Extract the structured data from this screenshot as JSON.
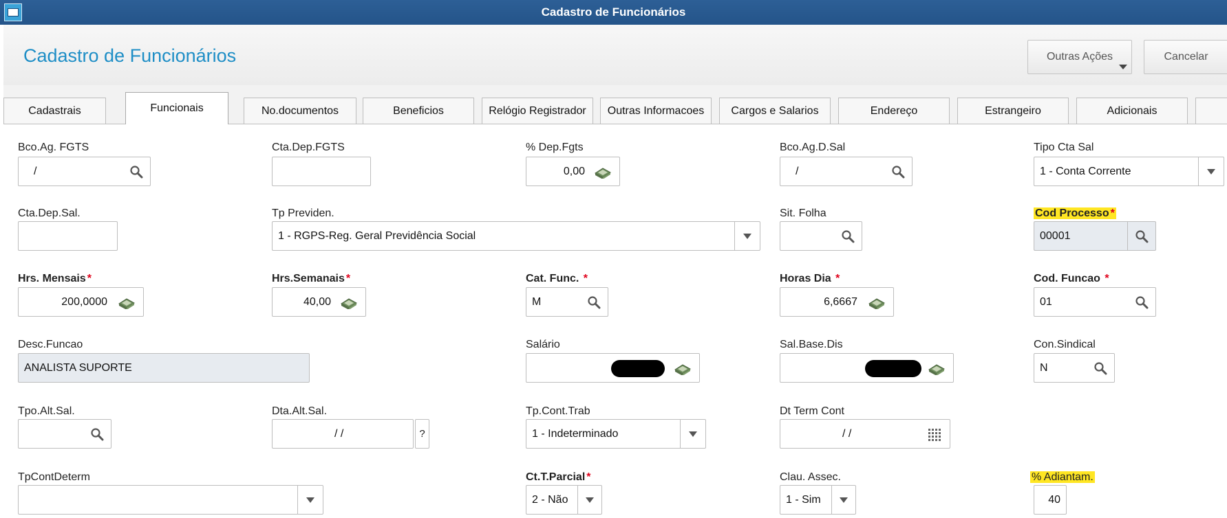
{
  "window": {
    "title": "Cadastro de Funcionários"
  },
  "header": {
    "title": "Cadastro de Funcionários",
    "other_actions": "Outras Ações",
    "cancel": "Cancelar"
  },
  "tabs": [
    {
      "label": "Cadastrais"
    },
    {
      "label": "Funcionais"
    },
    {
      "label": "No.documentos"
    },
    {
      "label": "Beneficios"
    },
    {
      "label": "Relógio Registrador"
    },
    {
      "label": "Outras Informacoes"
    },
    {
      "label": "Cargos e Salarios"
    },
    {
      "label": "Endereço"
    },
    {
      "label": "Estrangeiro"
    },
    {
      "label": "Adicionais"
    }
  ],
  "active_tab": "Funcionais",
  "fields": {
    "bco_ag_fgts": {
      "label": "Bco.Ag. FGTS",
      "value": "/"
    },
    "cta_dep_fgts": {
      "label": "Cta.Dep.FGTS",
      "value": ""
    },
    "pct_dep_fgts": {
      "label": "% Dep.Fgts",
      "value": "0,00"
    },
    "bco_ag_d_sal": {
      "label": "Bco.Ag.D.Sal",
      "value": "/"
    },
    "tipo_cta_sal": {
      "label": "Tipo Cta Sal",
      "value": "1 - Conta Corrente"
    },
    "cta_dep_sal": {
      "label": "Cta.Dep.Sal.",
      "value": ""
    },
    "tp_previden": {
      "label": "Tp Previden.",
      "value": "1 - RGPS-Reg. Geral Previdência Social"
    },
    "sit_folha": {
      "label": "Sit. Folha",
      "value": ""
    },
    "cod_processo": {
      "label": "Cod Processo",
      "value": "00001"
    },
    "hrs_mensais": {
      "label": "Hrs. Mensais",
      "value": "200,0000"
    },
    "hrs_semanais": {
      "label": "Hrs.Semanais",
      "value": "40,00"
    },
    "cat_func": {
      "label": "Cat. Func.",
      "value": "M"
    },
    "horas_dia": {
      "label": "Horas Dia",
      "value": "6,6667"
    },
    "cod_funcao": {
      "label": "Cod. Funcao",
      "value": "01"
    },
    "desc_funcao": {
      "label": "Desc.Funcao",
      "value": "ANALISTA SUPORTE"
    },
    "salario": {
      "label": "Salário",
      "value": ""
    },
    "sal_base_dis": {
      "label": "Sal.Base.Dis",
      "value": ""
    },
    "con_sindical": {
      "label": "Con.Sindical",
      "value": "N"
    },
    "tpo_alt_sal": {
      "label": "Tpo.Alt.Sal.",
      "value": ""
    },
    "dta_alt_sal": {
      "label": "Dta.Alt.Sal.",
      "value": "/  /",
      "help": "?"
    },
    "tp_cont_trab": {
      "label": "Tp.Cont.Trab",
      "value": "1 - Indeterminado"
    },
    "dt_term_cont": {
      "label": "Dt Term Cont",
      "value": "/  /"
    },
    "tp_cont_determ": {
      "label": "TpContDeterm",
      "value": ""
    },
    "ct_t_parcial": {
      "label": "Ct.T.Parcial",
      "value": "2 - Não"
    },
    "clau_assec": {
      "label": "Clau. Assec.",
      "value": "1 - Sim"
    },
    "pct_adiantam": {
      "label": "% Adiantam.",
      "value": "40"
    }
  },
  "required_mark": "*",
  "colors": {
    "title_bar": "#2a5a8f",
    "page_title": "#1e8ec6",
    "required": "#e0001a",
    "highlight": "#ffe623",
    "readonly_field": "#e7ebf0"
  },
  "icons": {
    "lookup": "magnifier-icon",
    "calculator": "calculator-icon",
    "dropdown": "chevron-down-icon",
    "calendar": "calendar-icon"
  }
}
